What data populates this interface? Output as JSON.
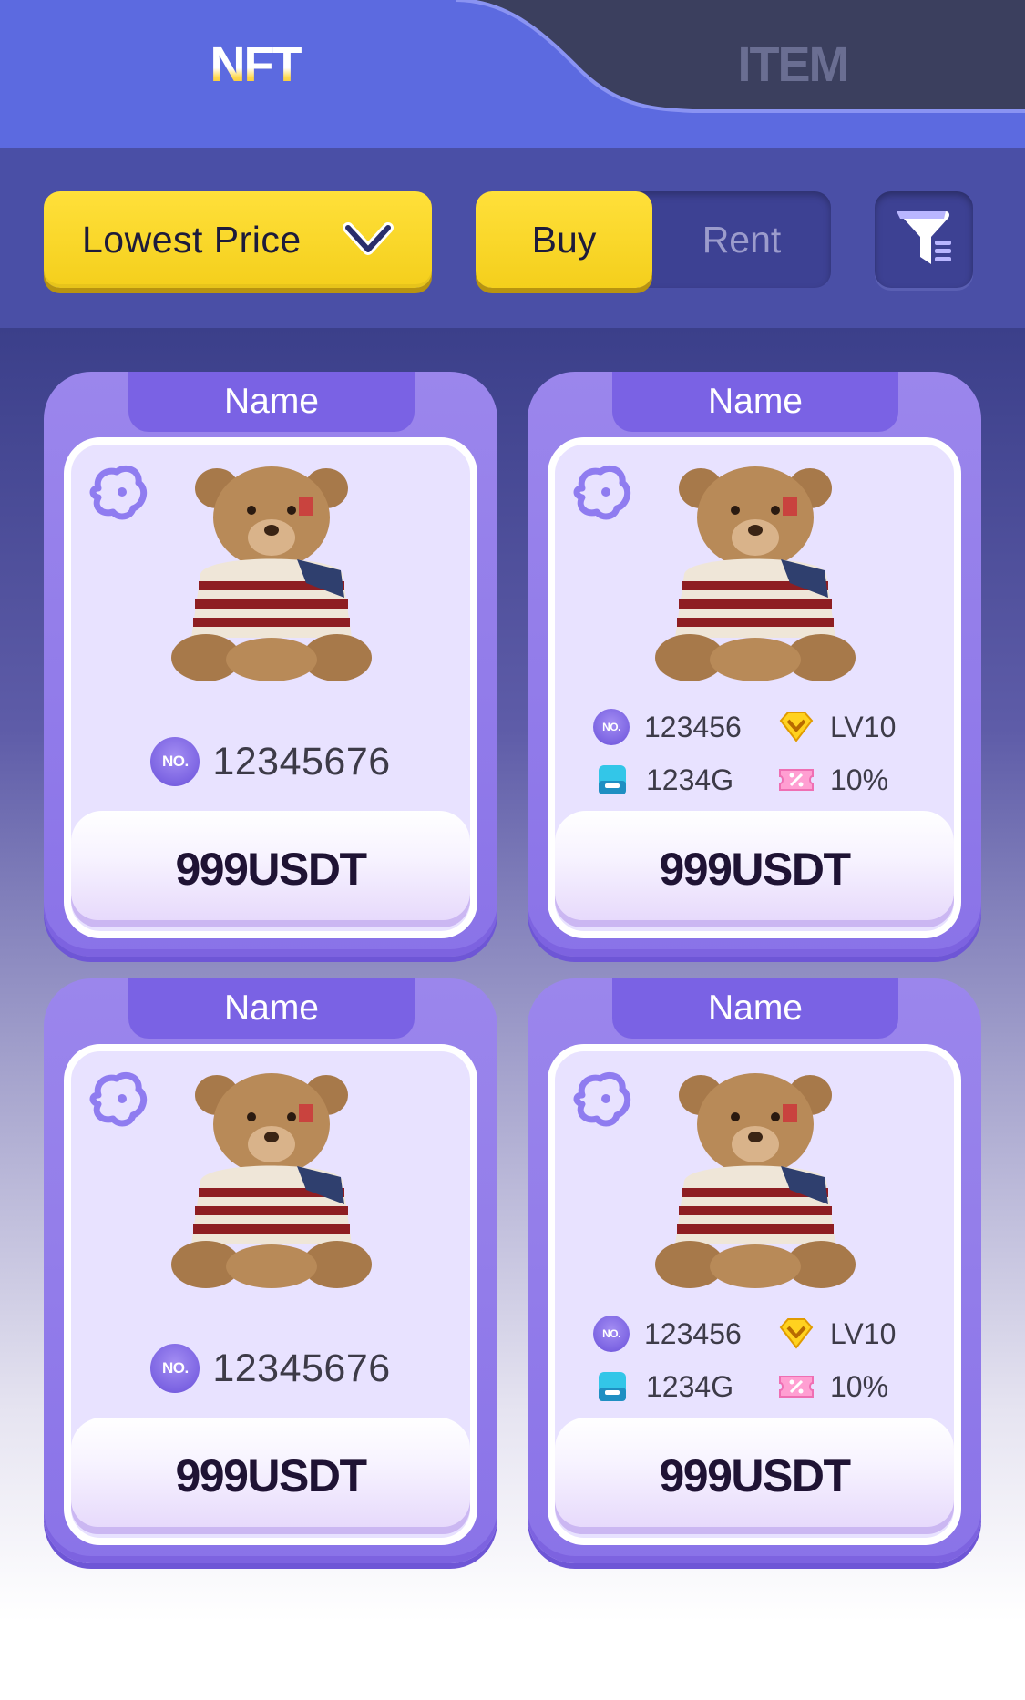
{
  "tabs": {
    "nft_label": "NFT",
    "item_label": "ITEM",
    "active": "NFT"
  },
  "toolbar": {
    "sort_label": "Lowest Price",
    "buy_label": "Buy",
    "rent_label": "Rent",
    "active_mode": "Buy",
    "filter_icon": "filter-icon"
  },
  "cards": [
    {
      "name": "Name",
      "no": "12345676",
      "price": "999USDT",
      "variant": "simple"
    },
    {
      "name": "Name",
      "no": "123456",
      "level": "LV10",
      "storage": "1234G",
      "discount": "10%",
      "price": "999USDT",
      "variant": "stats"
    },
    {
      "name": "Name",
      "no": "12345676",
      "price": "999USDT",
      "variant": "simple"
    },
    {
      "name": "Name",
      "no": "123456",
      "level": "LV10",
      "storage": "1234G",
      "discount": "10%",
      "price": "999USDT",
      "variant": "stats"
    }
  ],
  "badges": {
    "no_badge": "NO."
  },
  "colors": {
    "accent_yellow": "#f4cf1c",
    "card_purple": "#8a73e8",
    "toolbar_blue": "#4a4fa6",
    "tab_active": "#5c6ae0",
    "tab_inactive": "#3b3f5e"
  }
}
